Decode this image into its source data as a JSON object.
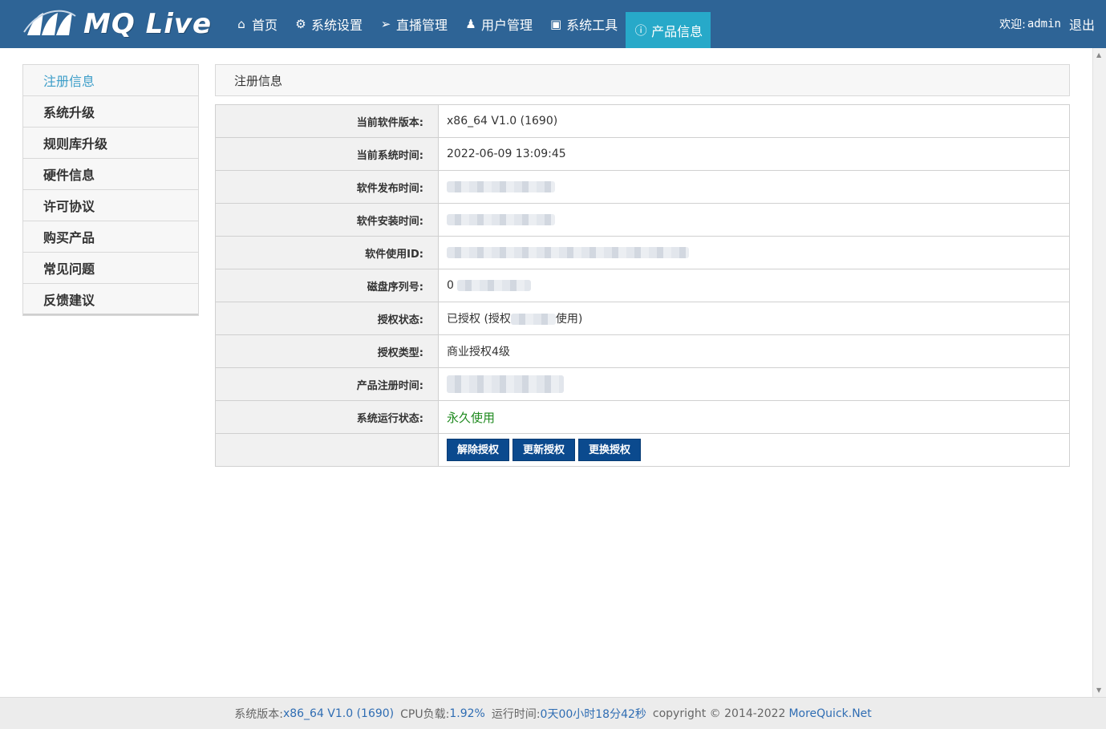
{
  "header": {
    "logo_text": "MQ Live",
    "nav": [
      {
        "icon": "home-icon",
        "label": "首页"
      },
      {
        "icon": "gears-icon",
        "label": "系统设置"
      },
      {
        "icon": "paper-plane-icon",
        "label": "直播管理"
      },
      {
        "icon": "user-icon",
        "label": "用户管理"
      },
      {
        "icon": "toolbox-icon",
        "label": "系统工具"
      },
      {
        "icon": "info-circle-icon",
        "label": "产品信息"
      }
    ],
    "active_nav": "产品信息",
    "welcome_label": "欢迎:",
    "username": "admin",
    "logout_label": "退出"
  },
  "sidebar": {
    "items": [
      {
        "label": "注册信息"
      },
      {
        "label": "系统升级"
      },
      {
        "label": "规则库升级"
      },
      {
        "label": "硬件信息"
      },
      {
        "label": "许可协议"
      },
      {
        "label": "购买产品"
      },
      {
        "label": "常见问题"
      },
      {
        "label": "反馈建议"
      }
    ],
    "active": "注册信息"
  },
  "panel": {
    "title": "注册信息",
    "rows": [
      {
        "label": "当前软件版本:",
        "value": "x86_64 V1.0 (1690)"
      },
      {
        "label": "当前系统时间:",
        "value": "2022-06-09 13:09:45"
      },
      {
        "label": "软件发布时间:",
        "value": ""
      },
      {
        "label": "软件安装时间:",
        "value": ""
      },
      {
        "label": "软件使用ID:",
        "value": ""
      },
      {
        "label": "磁盘序列号:",
        "value": "0"
      },
      {
        "label": "授权状态:",
        "value_prefix": "已授权 (授权",
        "value_suffix": "使用)"
      },
      {
        "label": "授权类型:",
        "value": "商业授权4级"
      },
      {
        "label": "产品注册时间:",
        "value": ""
      },
      {
        "label": "系统运行状态:",
        "value": "永久使用"
      }
    ],
    "buttons": [
      "解除授权",
      "更新授权",
      "更换授权"
    ]
  },
  "footer": {
    "version_label": "系统版本:",
    "version_value": "x86_64 V1.0 (1690)",
    "cpu_label": "CPU负载:",
    "cpu_value": "1.92%",
    "uptime_label": "运行时间:",
    "uptime_value": "0天00小时18分42秒",
    "copyright": "copyright © 2014-2022",
    "site": "MoreQuick.Net"
  },
  "colors": {
    "topbar": "#2e6496",
    "active_nav": "#27a9c9",
    "button": "#0b4a8e",
    "status_green": "#1f8a1f"
  }
}
